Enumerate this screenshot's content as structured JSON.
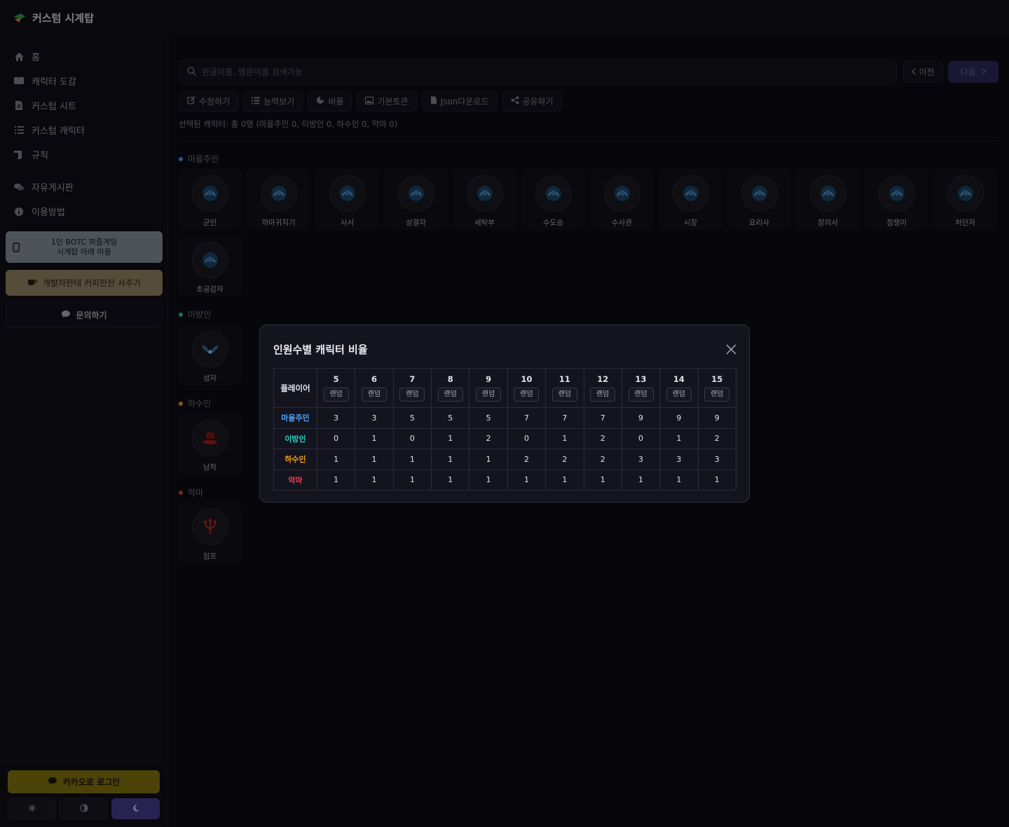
{
  "app": {
    "title": "커스텀 시계탑"
  },
  "sidebar": {
    "items": [
      {
        "label": "홈",
        "icon": "home-icon"
      },
      {
        "label": "캐릭터 도감",
        "icon": "book-icon"
      },
      {
        "label": "커스텀 시트",
        "icon": "file-icon"
      },
      {
        "label": "커스텀 캐릭터",
        "icon": "list-icon"
      },
      {
        "label": "규칙",
        "icon": "scroll-icon"
      },
      {
        "label": "자유게시판",
        "icon": "chat-icon"
      },
      {
        "label": "이용방법",
        "icon": "info-icon"
      }
    ],
    "promo1_line1": "1인 BOTC 퍼즐게임",
    "promo1_line2": "시계탑 아래 마을",
    "promo2": "개발자한테 커피한잔 사주기",
    "inquiry": "문의하기",
    "kakao_login": "카카오로 로그인"
  },
  "toolbar": {
    "search_placeholder": "한글이름, 영문이름 검색가능",
    "prev": "이전",
    "next": "다음",
    "buttons": [
      "수정하기",
      "능력보기",
      "비율",
      "기본토큰",
      "Json다운로드",
      "공유하기"
    ],
    "selected_info": "선택된 캐릭터: 총 0명 (마을주민 0, 이방인 0, 하수인 0, 악마 0)"
  },
  "groups": {
    "townsfolk": {
      "label": "마을주민",
      "color": "#4da3ff",
      "characters": [
        "군인",
        "까마귀지기",
        "사서",
        "성결자",
        "세탁부",
        "수도승",
        "수사관",
        "시장",
        "요리사",
        "장의사",
        "점쟁이",
        "처단자",
        "초공감자"
      ]
    },
    "outsider": {
      "label": "이방인",
      "color": "#2ad1c0",
      "characters": [
        "성자"
      ]
    },
    "minion": {
      "label": "하수인",
      "color": "#f0a020",
      "characters": [
        "남작"
      ]
    },
    "demon": {
      "label": "악마",
      "color": "#f0404a",
      "characters": [
        "임프"
      ]
    }
  },
  "modal": {
    "title": "인원수별 캐릭터 비율",
    "header_label": "플레이어",
    "random_label": "랜덤",
    "player_counts": [
      "5",
      "6",
      "7",
      "8",
      "9",
      "10",
      "11",
      "12",
      "13",
      "14",
      "15"
    ],
    "rows": [
      {
        "label": "마을주민",
        "values": [
          "3",
          "3",
          "5",
          "5",
          "5",
          "7",
          "7",
          "7",
          "9",
          "9",
          "9"
        ]
      },
      {
        "label": "이방인",
        "values": [
          "0",
          "1",
          "0",
          "1",
          "2",
          "0",
          "1",
          "2",
          "0",
          "1",
          "2"
        ]
      },
      {
        "label": "하수인",
        "values": [
          "1",
          "1",
          "1",
          "1",
          "1",
          "2",
          "2",
          "2",
          "3",
          "3",
          "3"
        ]
      },
      {
        "label": "악마",
        "values": [
          "1",
          "1",
          "1",
          "1",
          "1",
          "1",
          "1",
          "1",
          "1",
          "1",
          "1"
        ]
      }
    ]
  }
}
